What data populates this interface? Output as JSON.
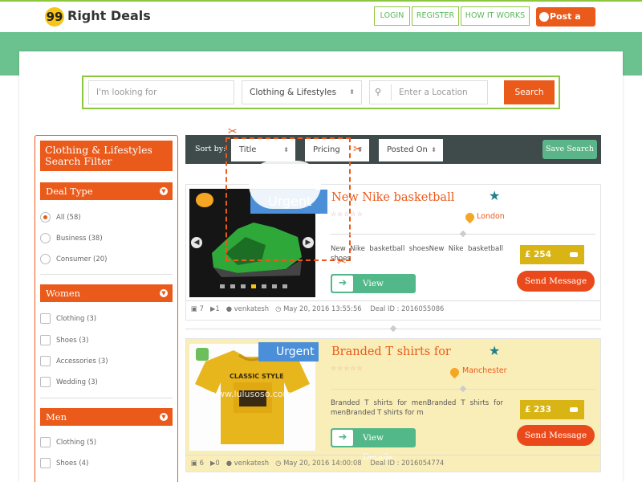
{
  "header": {
    "logo_mark": "99",
    "logo_text": "Right Deals",
    "nav": [
      "LOGIN",
      "REGISTER",
      "HOW IT WORKS"
    ],
    "post_button": "Post a deal"
  },
  "search": {
    "keyword_placeholder": "I'm looking for",
    "category_value": "Clothing & Lifestyles",
    "location_placeholder": "Enter a Location",
    "button": "Search"
  },
  "sidebar": {
    "title": "Clothing & Lifestyles Search Filter",
    "sections": [
      {
        "heading": "Deal Type",
        "type": "radio",
        "options": [
          {
            "label": "All (58)",
            "selected": true
          },
          {
            "label": "Business (38)",
            "selected": false
          },
          {
            "label": "Consumer (20)",
            "selected": false
          }
        ]
      },
      {
        "heading": "Women",
        "type": "checkbox",
        "options": [
          {
            "label": "Clothing (3)"
          },
          {
            "label": "Shoes (3)"
          },
          {
            "label": "Accessories (3)"
          },
          {
            "label": "Wedding (3)"
          }
        ]
      },
      {
        "heading": "Men",
        "type": "checkbox",
        "options": [
          {
            "label": "Clothing (5)"
          },
          {
            "label": "Shoes (4)"
          }
        ]
      }
    ]
  },
  "sortbar": {
    "label": "Sort by:",
    "selects": [
      "Title",
      "Pricing",
      "Posted On"
    ],
    "save_button": "Save Search"
  },
  "listings": [
    {
      "badge": "Urgent",
      "title": "New Nike basketball",
      "location": "London",
      "description": "New Nike basketball shoesNew Nike basketball shoes",
      "price": "£ 254",
      "view_button": "View Details",
      "send_button": "Send Message",
      "photos": "7",
      "videos": "1",
      "user": "venkatesh",
      "date": "May 20, 2016 13:55:56",
      "deal_id": "Deal ID : 2016055086"
    },
    {
      "badge": "Urgent",
      "title": "Branded T shirts for",
      "location": "Manchester",
      "description": "Branded T shirts for menBranded T shirts for menBranded T shirts for m",
      "price": "£ 233",
      "view_button": "View Details",
      "send_button": "Send Message",
      "photos": "6",
      "videos": "0",
      "user": "venkatesh",
      "date": "May 20, 2016 14:00:08",
      "deal_id": "Deal ID : 2016054774",
      "shirt_text": "CLASSIC STYLE",
      "watermark": "www.lulusoso.com"
    }
  ],
  "colors": {
    "accent": "#ea5a1b",
    "green": "#6cc28e",
    "dark": "#3f4a4a",
    "badge_blue": "#4a8fd8",
    "price_gold": "#d8b414"
  }
}
